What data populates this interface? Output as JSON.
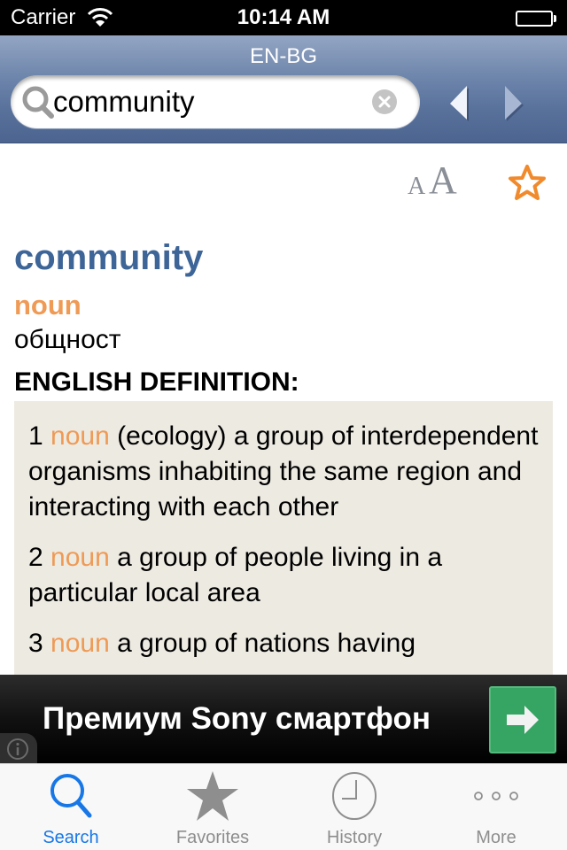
{
  "status_bar": {
    "carrier": "Carrier",
    "time": "10:14 AM",
    "wifi_icon": "wifi-icon",
    "battery_icon": "battery-full-icon"
  },
  "nav": {
    "title": "EN-BG",
    "search": {
      "value": "community",
      "icon": "search-icon",
      "clear_icon": "clear-icon"
    },
    "back_icon": "triangle-left-icon",
    "forward_icon": "triangle-right-icon"
  },
  "toolbar": {
    "font_size_small": "A",
    "font_size_large": "A",
    "favorite_icon": "star-outline-icon"
  },
  "entry": {
    "headword": "community",
    "part_of_speech": "noun",
    "translation": "общност",
    "definition_heading": "ENGLISH DEFINITION:",
    "senses": [
      {
        "num": "1",
        "pos": "noun",
        "text": "(ecology) a group of interdependent organisms inhabiting the same region and interacting with each other"
      },
      {
        "num": "2",
        "pos": "noun",
        "text": "a group of people living in a particular local area"
      },
      {
        "num": "3",
        "pos": "noun",
        "text": "a group of nations having"
      }
    ]
  },
  "ad": {
    "text": "Премиум Sony смартфон",
    "cta_icon": "arrow-right-icon",
    "info_icon": "info-icon"
  },
  "tabs": [
    {
      "label": "Search",
      "icon": "search-icon",
      "active": true
    },
    {
      "label": "Favorites",
      "icon": "star-icon",
      "active": false
    },
    {
      "label": "History",
      "icon": "clock-icon",
      "active": false
    },
    {
      "label": "More",
      "icon": "more-dots-icon",
      "active": false
    }
  ],
  "colors": {
    "headword": "#3d6597",
    "part_of_speech": "#ef9a55",
    "favorite": "#f08a2c",
    "tab_active": "#1877e6",
    "tab_inactive": "#8e8e8e",
    "ad_cta": "#36a564",
    "definition_bg": "#edeae2"
  }
}
